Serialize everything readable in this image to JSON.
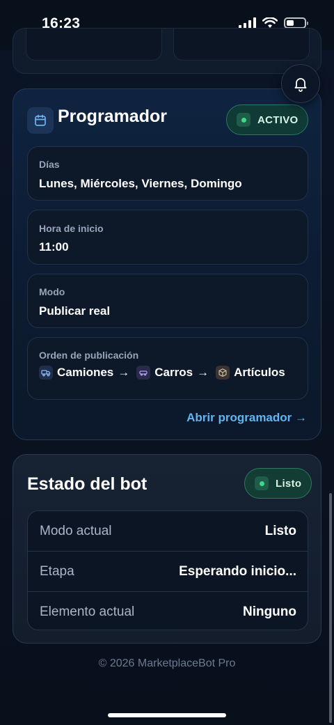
{
  "status_bar": {
    "time": "16:23"
  },
  "scheduler": {
    "title": "Programador",
    "status": "ACTIVO",
    "fields": {
      "days": {
        "label": "Días",
        "value": "Lunes, Miércoles, Viernes, Domingo"
      },
      "start_time": {
        "label": "Hora de inicio",
        "value": "11:00"
      },
      "mode": {
        "label": "Modo",
        "value": "Publicar real"
      },
      "order": {
        "label": "Orden de publicación",
        "items": [
          {
            "icon": "truck-icon",
            "label": "Camiones"
          },
          {
            "icon": "car-icon",
            "label": "Carros"
          },
          {
            "icon": "box-icon",
            "label": "Artículos"
          }
        ],
        "separator": "→"
      }
    },
    "link": "Abrir programador →"
  },
  "bot_status": {
    "title": "Estado del bot",
    "badge": "Listo",
    "rows": [
      {
        "key": "Modo actual",
        "value": "Listo"
      },
      {
        "key": "Etapa",
        "value": "Esperando inicio..."
      },
      {
        "key": "Elemento actual",
        "value": "Ninguno"
      }
    ]
  },
  "footer": "© 2026 MarketplaceBot Pro",
  "colors": {
    "accent": "#5fb6f0",
    "active_green": "#3ed889",
    "background": "#0b1426"
  }
}
